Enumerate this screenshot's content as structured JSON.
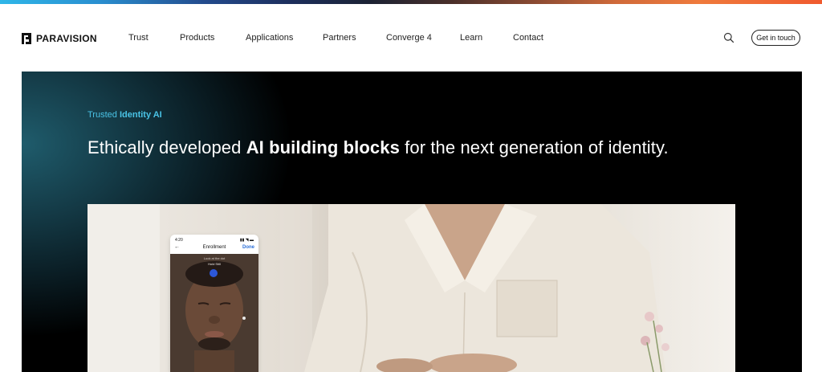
{
  "brand": {
    "name": "PARAVISION"
  },
  "nav": {
    "links": [
      "Trust",
      "Products",
      "Applications",
      "Partners",
      "Converge 4",
      "Learn",
      "Contact"
    ],
    "cta_label": "Get in touch",
    "search_icon": "search-icon"
  },
  "hero": {
    "eyebrow_plain": "Trusted",
    "eyebrow_bold": "Identity AI",
    "headline_pre": "Ethically developed",
    "headline_bold": "AI building blocks",
    "headline_post": "for the next generation of identity."
  },
  "phone": {
    "time": "4:20",
    "title": "Enrollment",
    "done": "Done",
    "hint_top": "Look at the dot",
    "hint_main": "Hold Still"
  },
  "colors": {
    "accent": "#4ac3e6",
    "hero_bg": "#000000",
    "phone_dot": "#2c57d8",
    "phone_done": "#2b6fd8"
  }
}
